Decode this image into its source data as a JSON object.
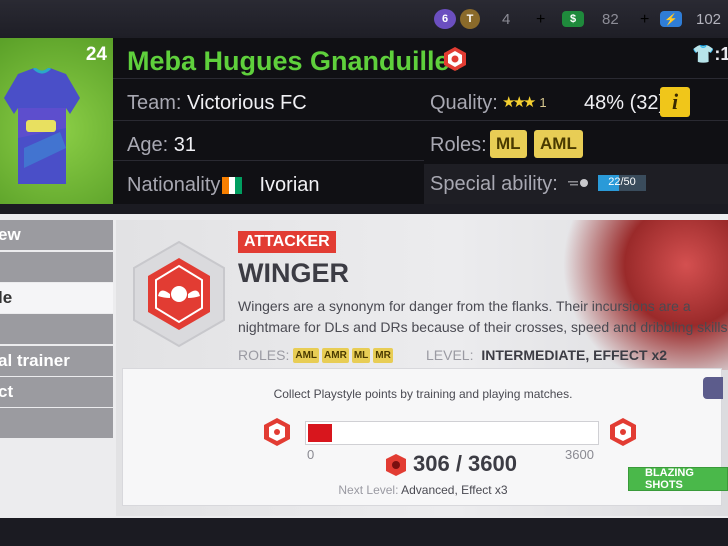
{
  "resources": {
    "gems": {
      "icon": "gem-icon",
      "value": "6"
    },
    "tokens": {
      "icon": "token-icon",
      "value": "4"
    },
    "cash": {
      "icon": "cash-icon",
      "value": "82"
    },
    "energy": {
      "icon": "energy-icon",
      "value": "102"
    },
    "plus": "+"
  },
  "player": {
    "shirt_number": "24",
    "name": "Meba Hugues Gnanduillet",
    "formation_label": "1",
    "team_label": "Team:",
    "team": "Victorious FC",
    "age_label": "Age:",
    "age": "31",
    "nationality_label": "Nationality:",
    "nationality": "Ivorian",
    "flag_colors": [
      "#f77f00",
      "#ffffff",
      "#009e60"
    ],
    "quality_label": "Quality:",
    "quality_stars": "★★★",
    "quality_extra": "1",
    "quality_pct": "48% (32)",
    "info": "i",
    "roles_label": "Roles:",
    "roles": [
      "ML",
      "AML"
    ],
    "special_label": "Special ability:",
    "special_progress": "22/50",
    "special_fraction": 0.44
  },
  "sidebar": {
    "items": [
      "ew",
      "",
      "le",
      "",
      "al trainer",
      "ct",
      ""
    ]
  },
  "playstyle": {
    "tag": "ATTACKER",
    "title": "WINGER",
    "description": "Wingers are a synonym for danger from the flanks. Their incursions are a nightmare for DLs and DRs because of their crosses, speed and dribbling skills.",
    "roles_label": "ROLES:",
    "roles": [
      "AML",
      "AMR",
      "ML",
      "MR"
    ],
    "level_label": "LEVEL:",
    "level": "INTERMEDIATE, EFFECT x2"
  },
  "progress": {
    "collect_text": "Collect Playstyle points by training and playing matches.",
    "min": "0",
    "max": "3600",
    "current": "306 / 3600",
    "fraction": 0.085,
    "next_label": "Next Level:",
    "next_value": "Advanced, Effect x3",
    "button": "BLAZING SHOTS"
  },
  "colors": {
    "name_green": "#5fd03c",
    "accent_red": "#e23c33",
    "chip_yellow": "#e8cd55",
    "button_green": "#4ab84a"
  }
}
